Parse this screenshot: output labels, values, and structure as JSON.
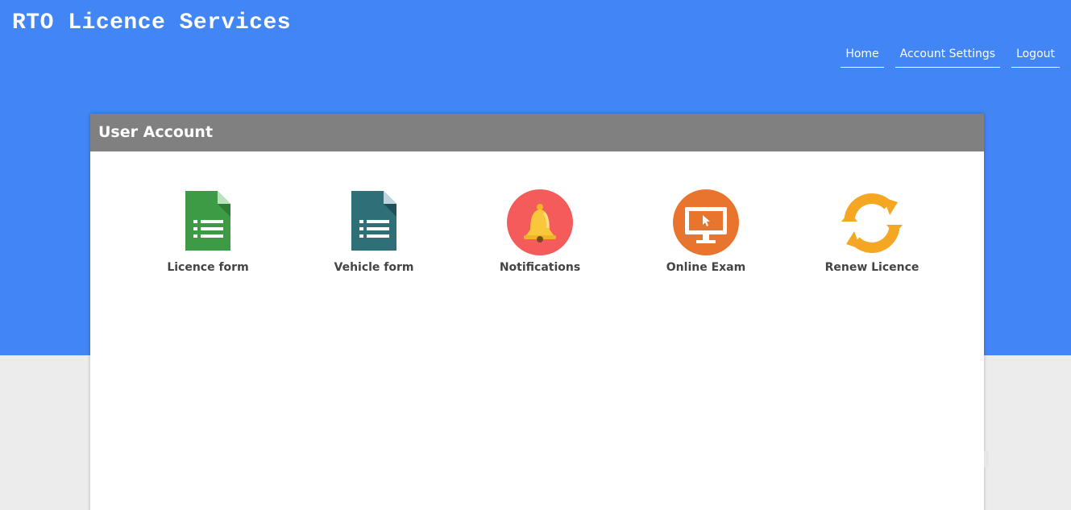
{
  "site": {
    "title": "RTO Licence Services"
  },
  "nav": {
    "items": [
      {
        "label": "Home"
      },
      {
        "label": "Account Settings"
      },
      {
        "label": "Logout"
      }
    ]
  },
  "panel": {
    "title": "User Account",
    "tiles": [
      {
        "label": "Licence form",
        "icon": "green-document-icon"
      },
      {
        "label": "Vehicle form",
        "icon": "teal-document-icon"
      },
      {
        "label": "Notifications",
        "icon": "bell-icon"
      },
      {
        "label": "Online Exam",
        "icon": "monitor-icon"
      },
      {
        "label": "Renew Licence",
        "icon": "refresh-arrows-icon"
      }
    ]
  },
  "colors": {
    "header_bg": "#4285f4",
    "panel_header_bg": "#808080",
    "page_bg": "#ececec",
    "licence_icon": "#3d9b45",
    "vehicle_icon": "#2f6f78",
    "notification_circle": "#f45b5b",
    "bell": "#f8c73a",
    "exam_circle": "#e8742d",
    "renew_arrows": "#f5a623"
  }
}
